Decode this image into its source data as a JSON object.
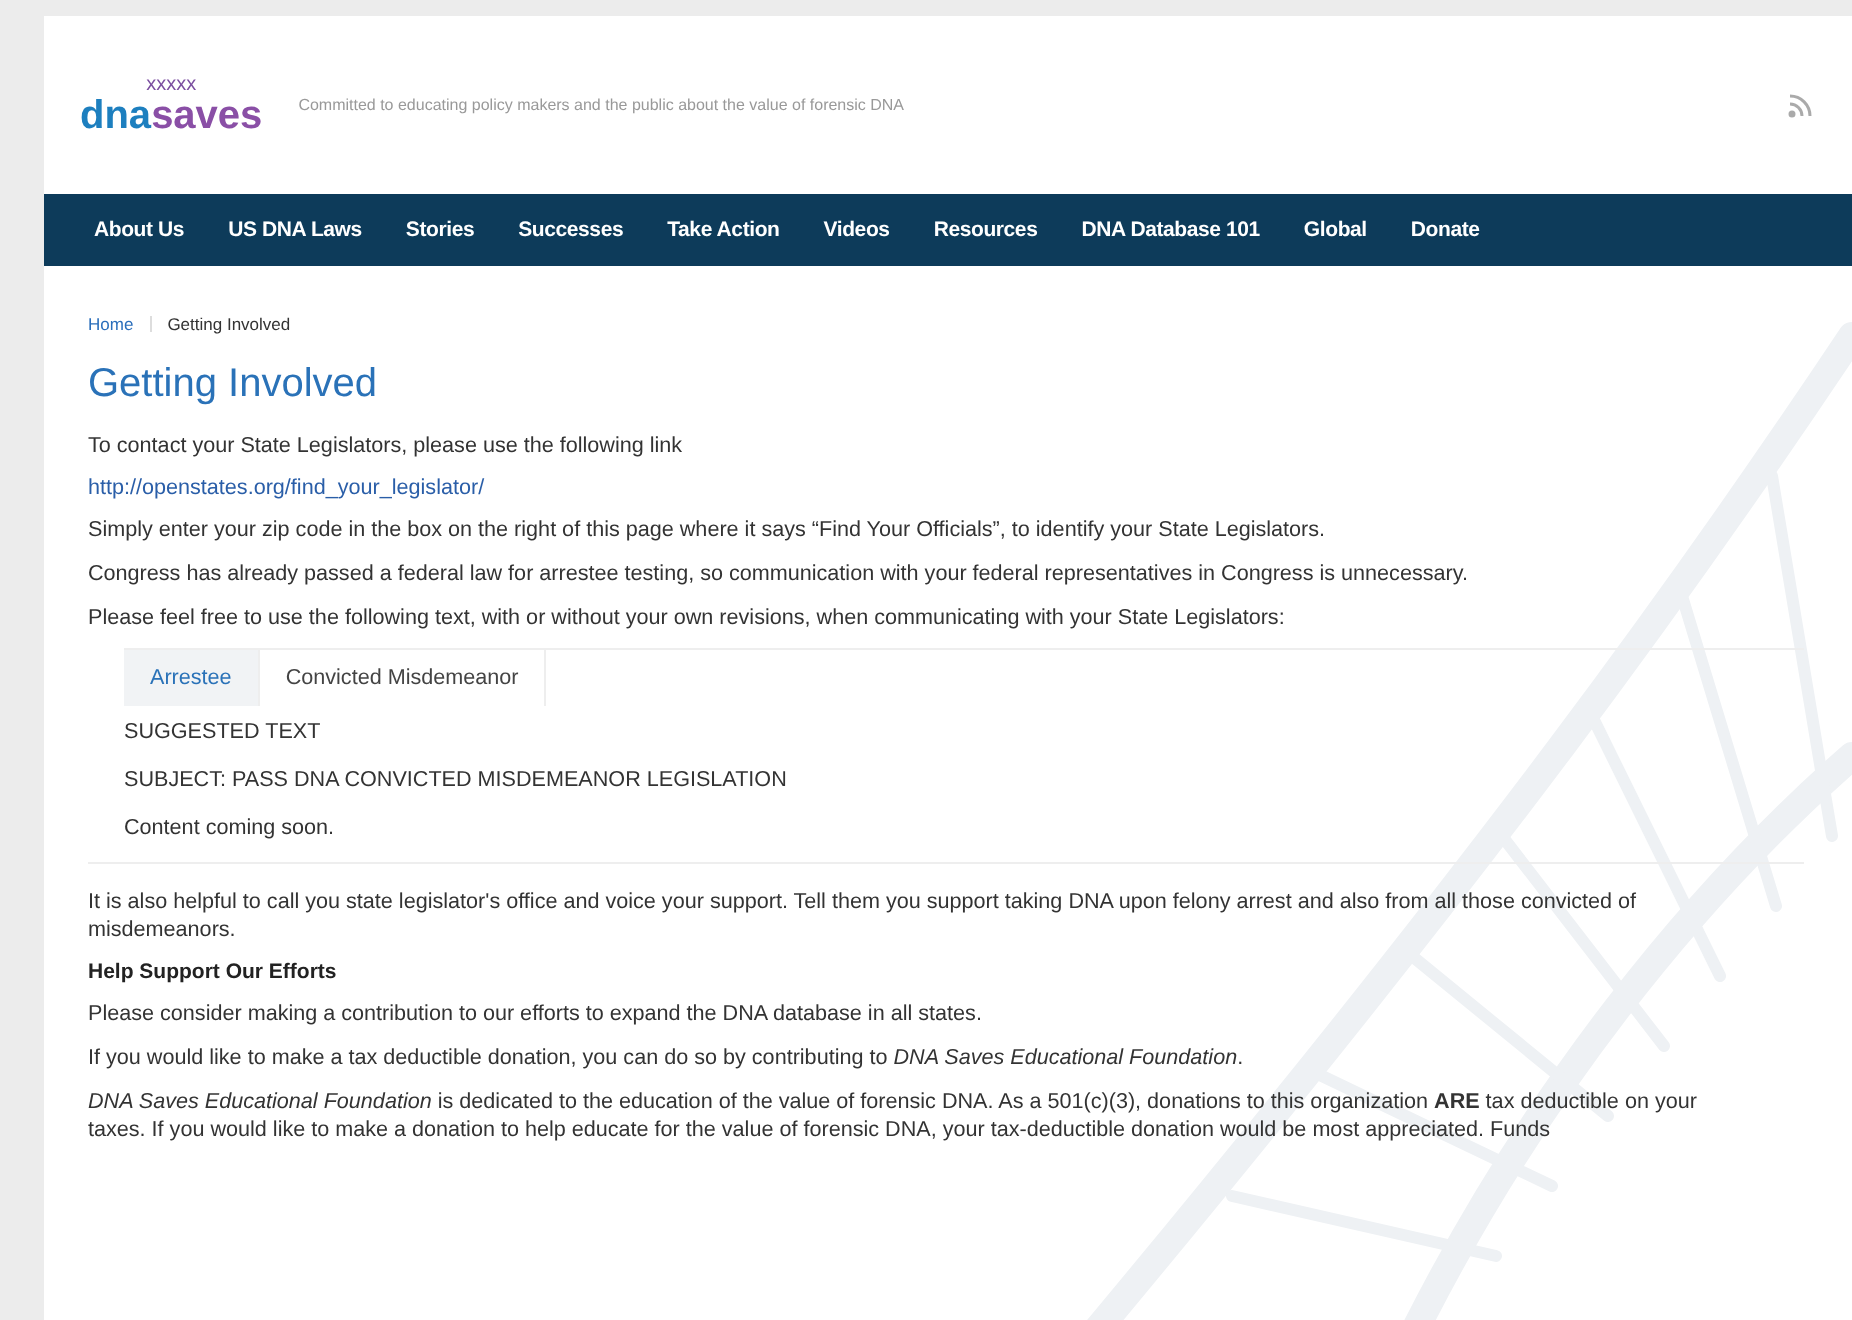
{
  "header": {
    "logo_stars": "xxxxx",
    "logo_dna": "dna",
    "logo_saves": "saves",
    "tagline": "Committed to educating policy makers and the public about the value of forensic DNA"
  },
  "nav": [
    "About Us",
    "US DNA Laws",
    "Stories",
    "Successes",
    "Take Action",
    "Videos",
    "Resources",
    "DNA Database 101",
    "Global",
    "Donate"
  ],
  "breadcrumb": [
    {
      "label": "Home",
      "kind": "link"
    },
    {
      "label": "Getting Involved",
      "kind": "current"
    }
  ],
  "title": "Getting Involved",
  "intro": [
    {
      "kind": "text",
      "text": "To contact your State Legislators, please use the following link"
    },
    {
      "kind": "link",
      "text": "http://openstates.org/find_your_legislator/"
    },
    {
      "kind": "text",
      "text": "Simply enter your zip code in the box on the right of this page where it says “Find Your Officials”, to identify your State Legislators."
    },
    {
      "kind": "text",
      "text": "Congress has already passed a federal law for arrestee testing, so communication with your federal representatives in Congress is unnecessary."
    },
    {
      "kind": "text",
      "text": "Please feel free to use the following text, with or without your own revisions, when communicating with your State Legislators:"
    }
  ],
  "tabs": [
    {
      "label": "Arrestee",
      "selected": true
    },
    {
      "label": "Convicted Misdemeanor",
      "selected": false
    }
  ],
  "tab_content": [
    "SUGGESTED TEXT",
    "SUBJECT: PASS DNA CONVICTED MISDEMEANOR LEGISLATION",
    "Content coming soon."
  ],
  "body": [
    {
      "kind": "text",
      "text": "It is also helpful to call you state legislator's office and voice your support.  Tell them you support taking DNA upon felony arrest and also from all those convicted of misdemeanors."
    },
    {
      "kind": "heading",
      "text": "Help Support Our Efforts"
    },
    {
      "kind": "text",
      "text": "Please consider making a contribution to our efforts to expand the DNA database in all states."
    },
    {
      "kind": "text",
      "text": "If you would like to make a tax deductible donation, you can do so by contributing to *DNA Saves Educational Foundation*."
    },
    {
      "kind": "text",
      "text": "*DNA Saves Educational Foundation* is dedicated to the education of the value of forensic DNA. As a 501(c)(3), donations to this organization **ARE** tax deductible on your taxes. If you would like to make a donation to help educate for the value of forensic DNA, your tax-deductible donation would be most appreciated. Funds"
    }
  ]
}
